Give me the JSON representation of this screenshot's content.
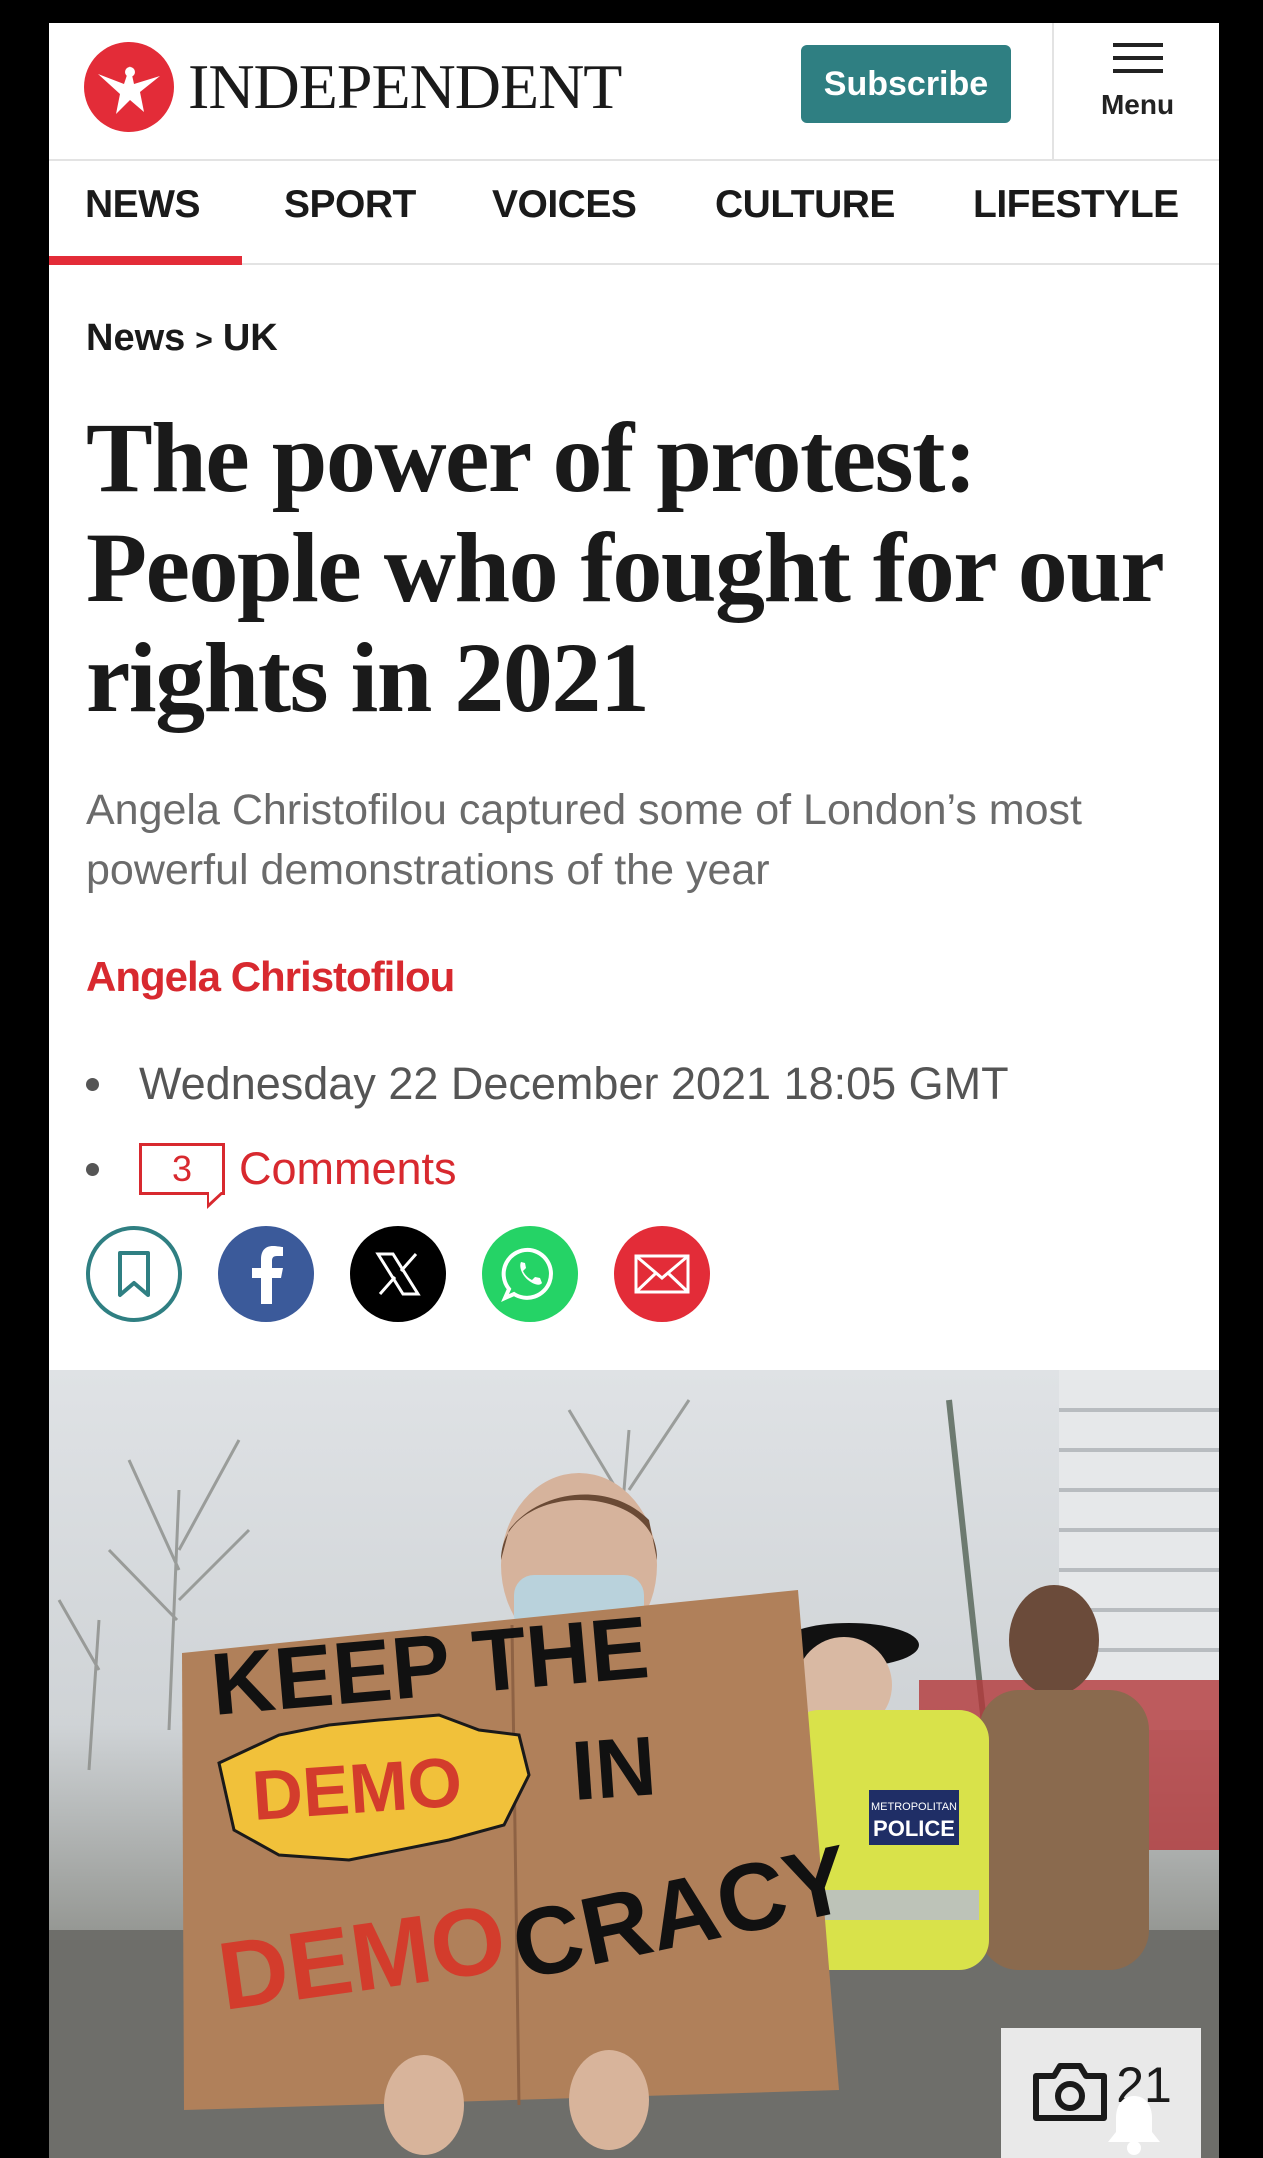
{
  "header": {
    "logo_text": "INDEPENDENT",
    "subscribe_label": "Subscribe",
    "menu_label": "Menu"
  },
  "nav": {
    "items": [
      "NEWS",
      "SPORT",
      "VOICES",
      "CULTURE",
      "LIFESTYLE"
    ],
    "active": "NEWS"
  },
  "breadcrumb": {
    "section": "News",
    "separator": ">",
    "subsection": "UK"
  },
  "article": {
    "headline": "The power of protest: People who fought for our rights in 2021",
    "standfirst": "Angela Christofilou captured some of London’s most powerful demonstrations of the year",
    "author": "Angela Christofilou",
    "date": "Wednesday 22 December 2021 18:05 GMT",
    "comment_count": "3",
    "comments_label": "Comments"
  },
  "share": {
    "icons": [
      "bookmark-icon",
      "facebook-icon",
      "x-icon",
      "whatsapp-icon",
      "email-icon"
    ]
  },
  "hero": {
    "sign_text": [
      "KEEP THE",
      "DEMO",
      "IN",
      "DEMO",
      "CRACY"
    ],
    "police_badge": [
      "METROPOLITAN",
      "POLICE"
    ],
    "gallery_count": "21"
  },
  "colors": {
    "brand_red": "#e32c38",
    "subscribe_teal": "#2f7f82",
    "byline_red": "#d8292f",
    "facebook": "#3b5a9a",
    "whatsapp": "#25d366",
    "email": "#e32c38"
  }
}
